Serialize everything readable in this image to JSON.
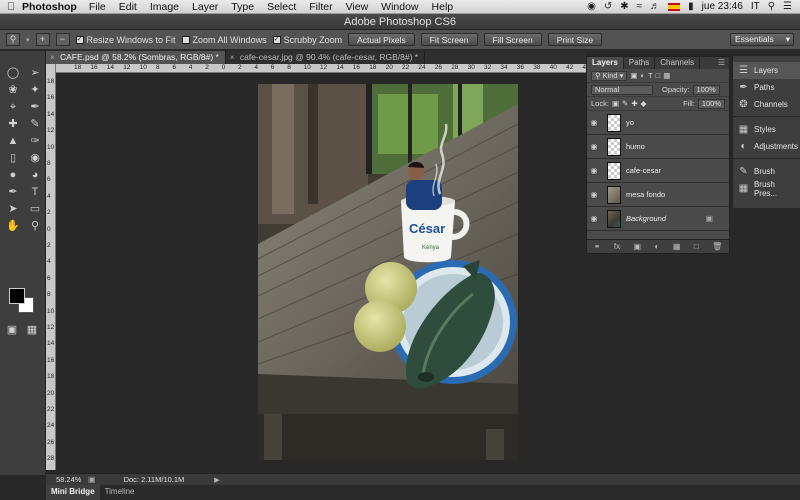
{
  "menubar": {
    "app_name": "Photoshop",
    "items": [
      "File",
      "Edit",
      "Image",
      "Layer",
      "Type",
      "Select",
      "Filter",
      "View",
      "Window",
      "Help"
    ],
    "clock": "jue 23:46",
    "input_lang": "IT"
  },
  "window": {
    "title": "Adobe Photoshop CS6"
  },
  "options": {
    "resize_windows": "Resize Windows to Fit",
    "zoom_all": "Zoom All Windows",
    "scrubby_zoom": "Scrubby Zoom",
    "actual_pixels": "Actual Pixels",
    "fit_screen": "Fit Screen",
    "fill_screen": "Fill Screen",
    "print_size": "Print Size",
    "workspace": "Essentials"
  },
  "tabs": [
    {
      "label": "CAFE.psd @ 58.2% (Sombras, RGB/8#) *"
    },
    {
      "label": "cafe-cesar.jpg @ 90.4% (cafe-cesar, RGB/8#) *"
    }
  ],
  "ruler": {
    "ticks": [
      "18",
      "16",
      "14",
      "12",
      "10",
      "8",
      "6",
      "4",
      "2",
      "0",
      "2",
      "4",
      "6",
      "8",
      "10",
      "12",
      "14",
      "16",
      "18",
      "20",
      "22",
      "24",
      "26",
      "28",
      "30",
      "32",
      "34",
      "36",
      "38",
      "40",
      "42",
      "44"
    ]
  },
  "photo": {
    "mug_text": "César",
    "mug_subtext": "Kenya"
  },
  "layers_panel": {
    "tabs": [
      "Layers",
      "Paths",
      "Channels"
    ],
    "filter": "Kind",
    "blend_mode": "Normal",
    "opacity_label": "Opacity:",
    "opacity_value": "100%",
    "lock_label": "Lock:",
    "fill_label": "Fill:",
    "fill_value": "100%",
    "layers": [
      {
        "name": "yo"
      },
      {
        "name": "humo"
      },
      {
        "name": "cafe-cesar"
      },
      {
        "name": "mesa fondo"
      },
      {
        "name": "Background"
      }
    ]
  },
  "dock": {
    "items": [
      {
        "label": "Layers"
      },
      {
        "label": "Paths"
      },
      {
        "label": "Channels"
      },
      {
        "label": "Styles"
      },
      {
        "label": "Adjustments"
      },
      {
        "label": "Brush"
      },
      {
        "label": "Brush Pres..."
      }
    ]
  },
  "status": {
    "zoom": "58.24%",
    "doc": "Doc: 2.11M/10.1M"
  },
  "bottom_tabs": [
    {
      "label": "Mini Bridge"
    },
    {
      "label": "Timeline"
    }
  ]
}
